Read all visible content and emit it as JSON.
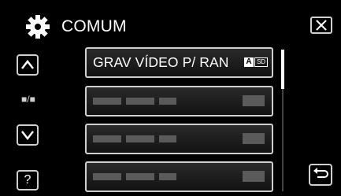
{
  "header": {
    "title": "COMUM"
  },
  "menu": {
    "items": [
      {
        "label": "GRAV VÍDEO P/ RAN",
        "badge_a": "A",
        "badge_sd": "SD"
      }
    ]
  },
  "side": {
    "page_indicator": "■/■",
    "help_label": "?"
  },
  "colors": {
    "background": "#000000",
    "border": "#cfcfcf",
    "placeholder": "#5a5a5a"
  }
}
